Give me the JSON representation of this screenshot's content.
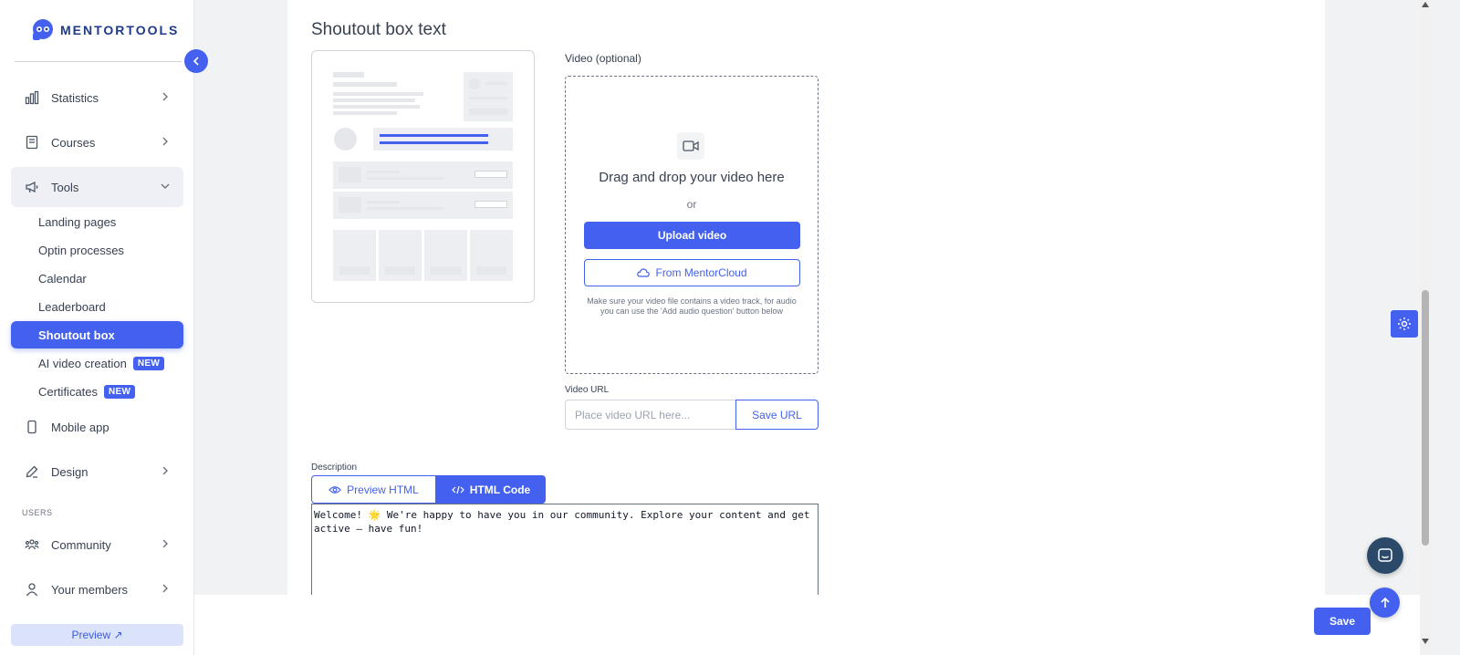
{
  "brand": {
    "name": "MENTORTOOLS",
    "accent": "#4361ee"
  },
  "sidebar": {
    "items": [
      {
        "label": "Statistics",
        "icon": "bar-chart-icon"
      },
      {
        "label": "Courses",
        "icon": "book-icon"
      },
      {
        "label": "Tools",
        "icon": "megaphone-icon"
      }
    ],
    "tools_sub": [
      {
        "label": "Landing pages"
      },
      {
        "label": "Optin processes"
      },
      {
        "label": "Calendar"
      },
      {
        "label": "Leaderboard"
      },
      {
        "label": "Shoutout box"
      },
      {
        "label": "AI video creation",
        "badge": "NEW"
      },
      {
        "label": "Certificates",
        "badge": "NEW"
      }
    ],
    "mobile_app": "Mobile app",
    "design": "Design",
    "users_section": "USERS",
    "community": "Community",
    "your_members": "Your members",
    "preview": "Preview ↗"
  },
  "main": {
    "title": "Shoutout box text",
    "video": {
      "label": "Video (optional)",
      "drag_text": "Drag and drop your video here",
      "or": "or",
      "upload": "Upload video",
      "cloud": "From MentorCloud",
      "hint": "Make sure your video file contains a video track, for audio you can use the 'Add audio question' button below"
    },
    "url": {
      "label": "Video URL",
      "placeholder": "Place video URL here...",
      "button": "Save URL"
    },
    "description": {
      "label": "Description",
      "tab_preview": "Preview HTML",
      "tab_code": "HTML Code",
      "code": "Welcome! 🌟 We're happy to have you in our community. Explore your content and get active – have fun!"
    }
  },
  "footer": {
    "save": "Save"
  }
}
